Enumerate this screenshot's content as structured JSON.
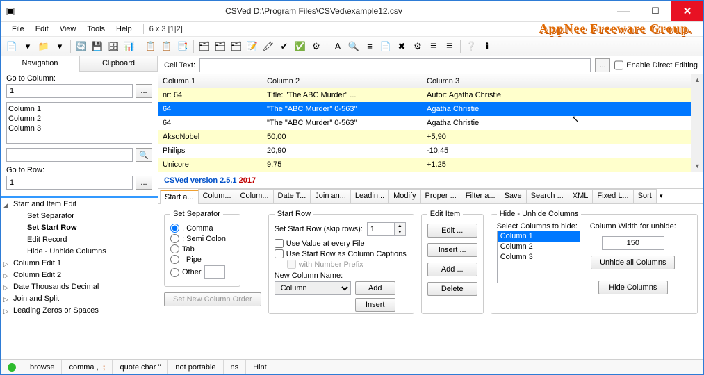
{
  "window": {
    "title": "CSVed D:\\Program Files\\CSVed\\example12.csv"
  },
  "menus": [
    "File",
    "Edit",
    "View",
    "Tools",
    "Help"
  ],
  "menu_info": "6 x 3 [1|2]",
  "brand": "AppNee Freeware Group.",
  "toolbar_icons": [
    "📄",
    "▾",
    "📁",
    "▾",
    "|",
    "🔄",
    "💾",
    "🗄",
    "📊",
    "|",
    "📋",
    "📋",
    "📑",
    "|",
    "🗂",
    "🗂",
    "🗂",
    "📝",
    "🖍",
    "✔",
    "✅",
    "⚙",
    "|",
    "A",
    "🔍",
    "≡",
    "📄",
    "✖",
    "⚙",
    "≣",
    "≣",
    "|",
    "❔",
    "ℹ"
  ],
  "nav": {
    "tabs": [
      "Navigation",
      "Clipboard"
    ],
    "goto_col_label": "Go to Column:",
    "goto_col_val": "1",
    "columns": [
      "Column 1",
      "Column 2",
      "Column 3"
    ],
    "goto_row_label": "Go to Row:",
    "goto_row_val": "1"
  },
  "tree": [
    {
      "t": "Start and Item Edit",
      "l": 1,
      "tw": "◢"
    },
    {
      "t": "Set Separator",
      "l": 2,
      "tw": ""
    },
    {
      "t": "Set Start Row",
      "l": 2,
      "tw": "",
      "b": true
    },
    {
      "t": "Edit Record",
      "l": 2,
      "tw": ""
    },
    {
      "t": "Hide - Unhide Columns",
      "l": 2,
      "tw": ""
    },
    {
      "t": "Column Edit 1",
      "l": 1,
      "tw": "▷"
    },
    {
      "t": "Column Edit 2",
      "l": 1,
      "tw": "▷"
    },
    {
      "t": "Date Thousands Decimal",
      "l": 1,
      "tw": "▷"
    },
    {
      "t": "Join and Split",
      "l": 1,
      "tw": "▷"
    },
    {
      "t": "Leading Zeros or Spaces",
      "l": 1,
      "tw": "▷"
    }
  ],
  "celltext": {
    "label": "Cell Text:",
    "enable": "Enable Direct Editing"
  },
  "grid": {
    "head": [
      "Column 1",
      "Column 2",
      "Column 3"
    ],
    "rows": [
      {
        "c": [
          "nr: 64",
          "Title: \"The ABC Murder\" ...",
          "Autor: Agatha Christie"
        ],
        "cls": "yel"
      },
      {
        "c": [
          "64",
          "\"The \"ABC Murder\" 0-563\"",
          "Agatha Christie"
        ],
        "cls": "sel"
      },
      {
        "c": [
          "64",
          "\"The \"ABC Murder\" 0-563\"",
          "Agatha Christie"
        ],
        "cls": "wht"
      },
      {
        "c": [
          "AksoNobel",
          "50,00",
          "+5,90"
        ],
        "cls": "yel"
      },
      {
        "c": [
          "Philips",
          "20,90",
          "-10,45"
        ],
        "cls": "wht"
      },
      {
        "c": [
          "Unicore",
          "9.75",
          "+1.25"
        ],
        "cls": "yel"
      }
    ]
  },
  "version": {
    "a": "CSVed version 2.5.1",
    "b": " 2017"
  },
  "tabs2": [
    "Start a...",
    "Colum...",
    "Colum...",
    "Date T...",
    "Join an...",
    "Leadin...",
    "Modify",
    "Proper ...",
    "Filter a...",
    "Save",
    "Search ...",
    "XML",
    "Fixed L...",
    "Sort"
  ],
  "panel": {
    "sep": {
      "legend": "Set Separator",
      "opts": [
        ", Comma",
        "; Semi Colon",
        "Tab",
        "| Pipe",
        "Other"
      ]
    },
    "start": {
      "legend": "Start Row",
      "skip": "Set Start Row (skip rows):",
      "skip_val": "1",
      "use_every": "Use Value at every File",
      "use_caption": "Use Start Row as Column Captions",
      "with_prefix": "with Number Prefix",
      "newcol": "New Column Name:",
      "newcol_val": "Column",
      "add": "Add",
      "insert": "Insert",
      "set_order": "Set New Column Order"
    },
    "edit": {
      "legend": "Edit Item",
      "btns": [
        "Edit ...",
        "Insert ...",
        "Add ...",
        "Delete"
      ]
    },
    "hide": {
      "legend": "Hide - Unhide Columns",
      "select": "Select Columns to hide:",
      "cols": [
        "Column 1",
        "Column 2",
        "Column 3"
      ],
      "width_lbl": "Column Width for unhide:",
      "width_val": "150",
      "unhide": "Unhide all Columns",
      "hidebtn": "Hide Columns"
    }
  },
  "status": [
    "browse",
    "comma ,",
    "quote char \"",
    "not portable",
    "ns",
    "Hint"
  ],
  "semi": ";"
}
